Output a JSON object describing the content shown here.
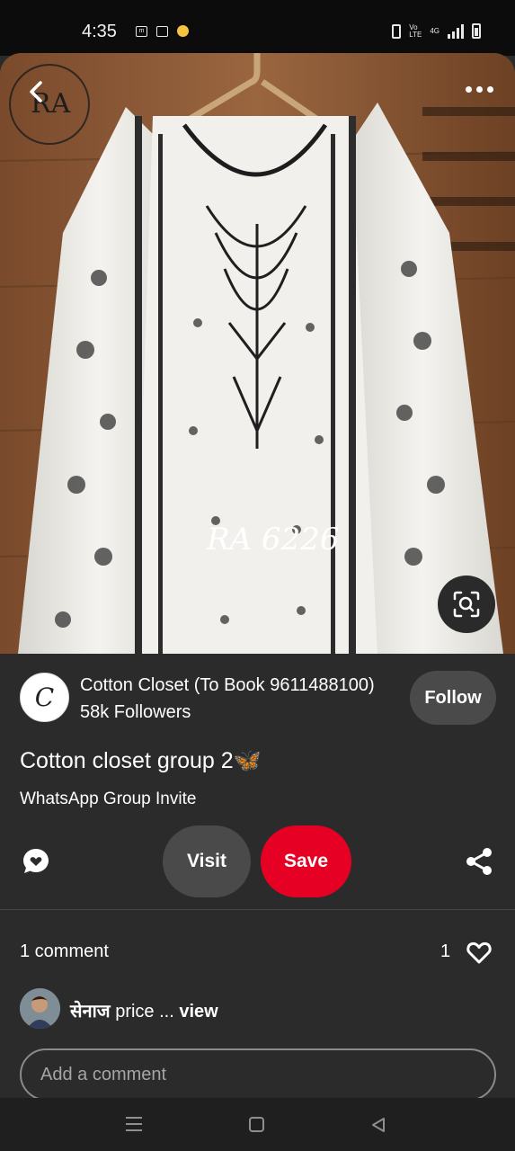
{
  "status_bar": {
    "time": "4:35",
    "network_label": "4G"
  },
  "pin": {
    "image_label": "RA 6226",
    "image_logo": "RA"
  },
  "creator": {
    "name": "Cotton Closet (To Book 9611488100)",
    "followers": "58k Followers",
    "follow_label": "Follow",
    "avatar_letter": "C"
  },
  "title": "Cotton closet group 2🦋",
  "description": "WhatsApp Group Invite",
  "actions": {
    "visit_label": "Visit",
    "save_label": "Save"
  },
  "comments": {
    "heading": "1 comment",
    "likes": "1",
    "items": [
      {
        "author": "सेनाज",
        "text": " price ... ",
        "more": "view"
      }
    ],
    "placeholder": "Add a comment"
  },
  "colors": {
    "save": "#e60023",
    "background": "#2b2b2b",
    "pill": "#4a4a4a"
  }
}
